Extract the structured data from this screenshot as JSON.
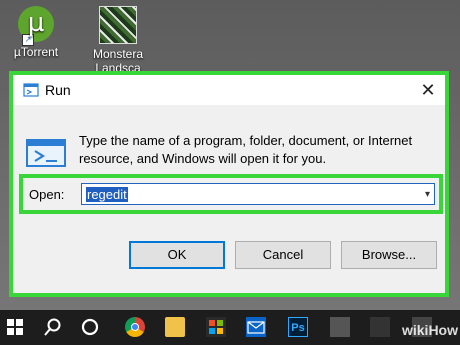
{
  "desktop": {
    "icons": [
      {
        "label": "µTorrent"
      },
      {
        "label": "Monstera Landsca"
      }
    ]
  },
  "dialog": {
    "title": "Run",
    "close_glyph": "✕",
    "description": "Type the name of a program, folder, document, or Internet resource, and Windows will open it for you.",
    "open_label": "Open:",
    "open_value": "regedit",
    "buttons": {
      "ok": "OK",
      "cancel": "Cancel",
      "browse": "Browse..."
    }
  },
  "taskbar": {
    "items": [
      "windows-start-icon",
      "search-icon",
      "cortana-icon",
      "chrome-icon",
      "file-explorer-icon",
      "store-icon",
      "mail-icon",
      "photoshop-icon",
      "notes-icon",
      "app-icon",
      "app-icon"
    ],
    "ps_label": "Ps"
  },
  "watermark": "wikiHow",
  "colors": {
    "highlight_border": "#39d63a",
    "selection": "#1f5fbf",
    "ok_focus": "#0078d7"
  }
}
